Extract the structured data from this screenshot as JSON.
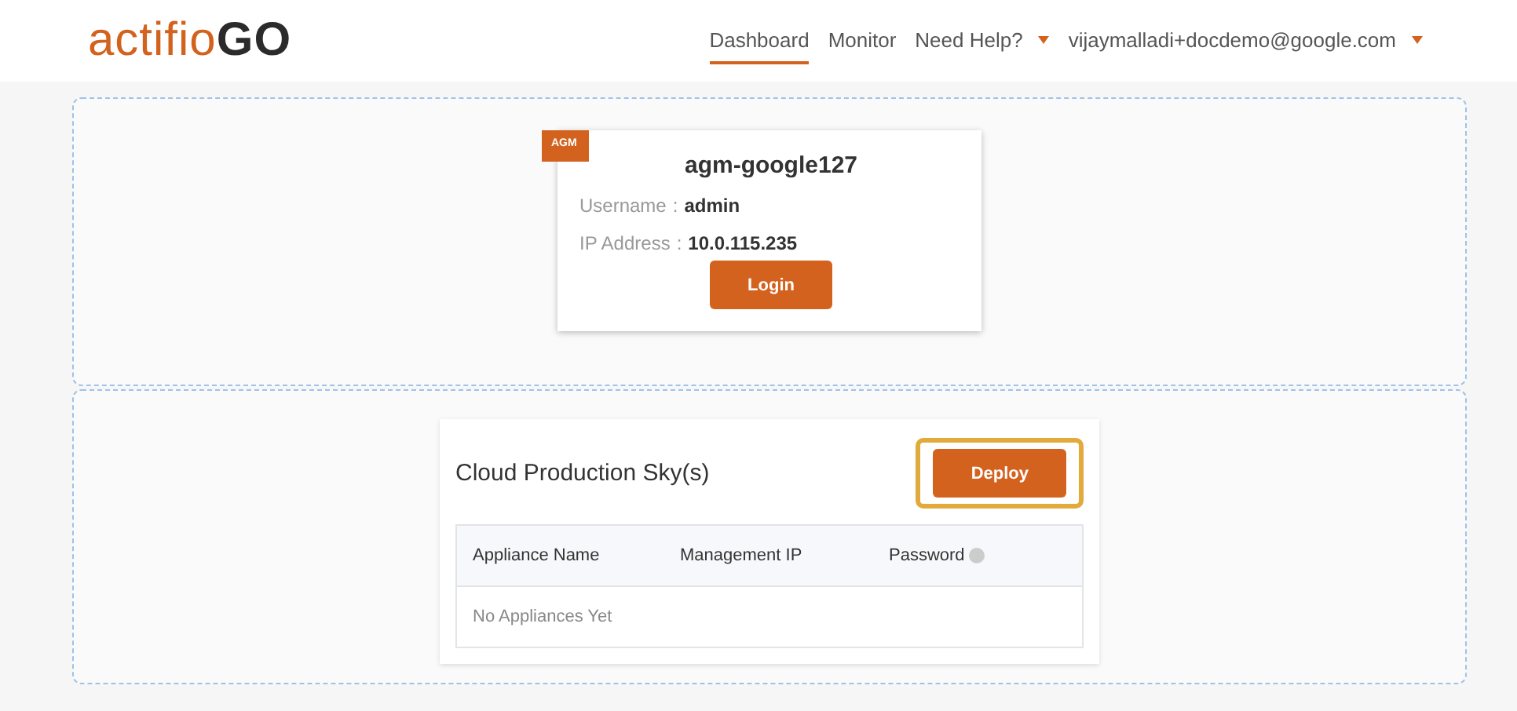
{
  "header": {
    "logo": "actifio**GO**",
    "nav": [
      {
        "label": "Dashboard",
        "selected": true,
        "dropdown": false
      },
      {
        "label": "Monitor",
        "selected": false,
        "dropdown": false
      },
      {
        "label": "Need Help?",
        "selected": false,
        "dropdown": true
      },
      {
        "label": "vijaymalladi+docdemo@google.com",
        "selected": false,
        "dropdown": true
      }
    ]
  },
  "appliance_card": {
    "badge": "AGM",
    "name": "agm-google127",
    "fields": [
      {
        "label": "Username",
        "separator": ":",
        "value": "admin"
      },
      {
        "label": "IP Address",
        "separator": ":",
        "value": "10.0.115.235"
      }
    ],
    "button": "Login"
  },
  "sky_panel": {
    "title": "Cloud Production Sky(s)",
    "button": {
      "label": "Deploy",
      "highlighted": true
    },
    "columns": [
      "Appliance Name",
      "Management IP",
      "Password"
    ],
    "empty_text": "No Appliances Yet"
  }
}
